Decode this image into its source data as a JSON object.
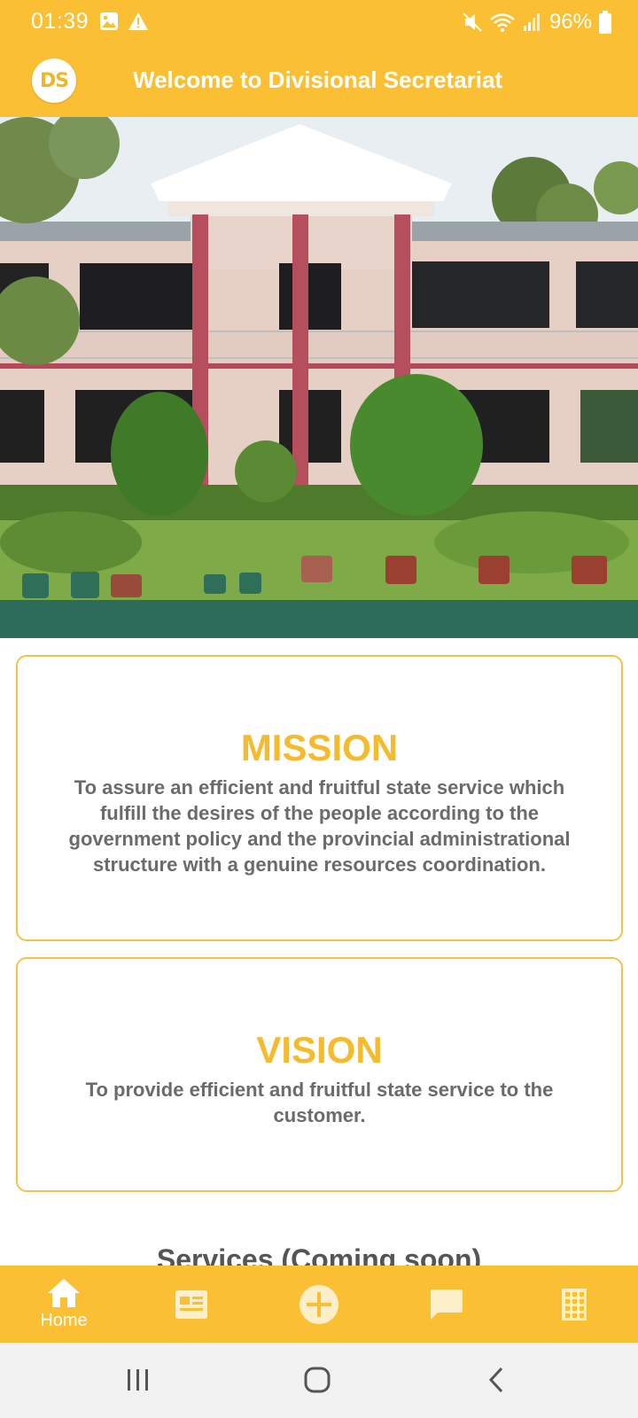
{
  "status_bar": {
    "time": "01:39",
    "battery": "96%",
    "icons": [
      "image-icon",
      "warning-icon",
      "mute-icon",
      "wifi-icon",
      "signal-icon",
      "battery-icon"
    ]
  },
  "app_bar": {
    "logo_text": "DS",
    "title": "Welcome to Divisional Secretariat"
  },
  "hero": {
    "description_icon": "building-photo"
  },
  "mission": {
    "title": "MISSION",
    "text": "To assure an efficient and fruitful state service which fulfill the desires of the people according to the government policy and the provincial administrational structure with a genuine resources coordination."
  },
  "vision": {
    "title": "VISION",
    "text": "To provide efficient and fruitful state service to the customer."
  },
  "services": {
    "heading": "Services (Coming soon)"
  },
  "bottom_nav": {
    "items": [
      {
        "label": "Home",
        "icon": "home-icon",
        "active": true
      },
      {
        "label": "",
        "icon": "news-icon",
        "active": false
      },
      {
        "label": "",
        "icon": "add-circle-icon",
        "active": false
      },
      {
        "label": "",
        "icon": "chat-icon",
        "active": false
      },
      {
        "label": "",
        "icon": "grid-icon",
        "active": false
      }
    ]
  },
  "colors": {
    "accent": "#fbbf33",
    "title_yellow": "#f5bb2c",
    "body_text": "#6b6b6b"
  }
}
